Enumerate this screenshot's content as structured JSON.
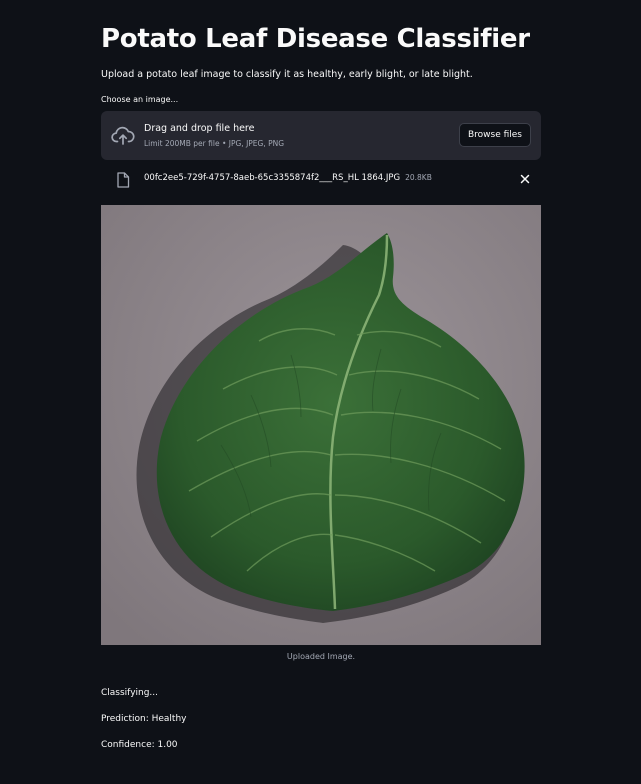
{
  "app": {
    "title": "Potato Leaf Disease Classifier",
    "description": "Upload a potato leaf image to classify it as healthy, early blight, or late blight."
  },
  "uploader": {
    "label": "Choose an image...",
    "drag_text": "Drag and drop file here",
    "limit_text": "Limit 200MB per file • JPG, JPEG, PNG",
    "browse_label": "Browse files",
    "icon": "cloud-upload-icon"
  },
  "uploaded_file": {
    "name": "00fc2ee5-729f-4757-8aeb-65c3355874f2___RS_HL 1864.JPG",
    "size": "20.8KB",
    "icon": "file-icon",
    "remove_icon": "close-icon"
  },
  "image": {
    "caption": "Uploaded Image."
  },
  "results": {
    "status": "Classifying...",
    "prediction": "Prediction: Healthy",
    "confidence": "Confidence: 1.00"
  },
  "colors": {
    "background": "#0e1117",
    "panel": "#262730",
    "text": "#fafafa",
    "muted_text": "#a3a8b4",
    "leaf_green": "#2f5d30",
    "photo_background": "#8c8489"
  }
}
